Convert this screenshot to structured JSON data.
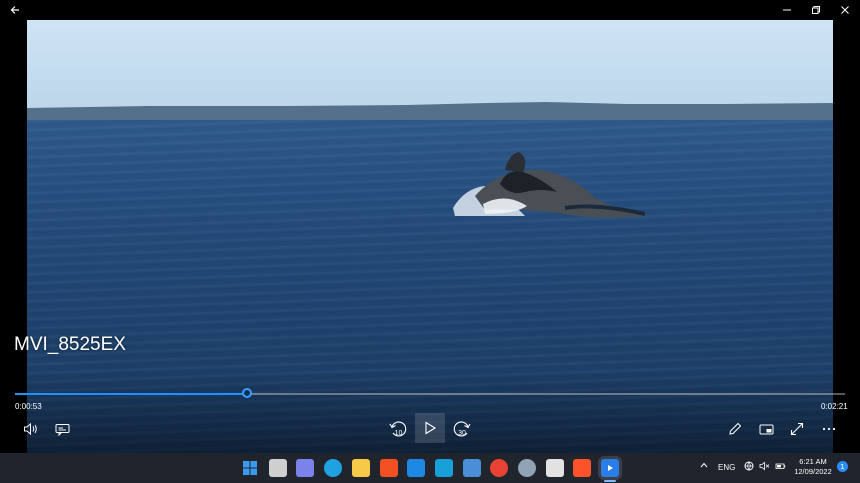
{
  "video": {
    "title": "MVI_8525EX",
    "elapsed": "0:00:53",
    "duration": "0:02:21",
    "progress": 0.2809
  },
  "controls": {
    "skip_back_label": "10",
    "skip_forward_label": "30"
  },
  "taskbar": {
    "tray": {
      "language": "ENG",
      "time": "6:21 AM",
      "date": "12/09/2022",
      "notification_count": "1"
    },
    "apps": [
      {
        "icon": "windows-start-icon",
        "color": "#3a9bf0"
      },
      {
        "icon": "task-view-icon",
        "color": "#cfcfcf"
      },
      {
        "icon": "chat-icon",
        "color": "#7b83eb"
      },
      {
        "icon": "edge-icon",
        "color": "#1fa3e0"
      },
      {
        "icon": "file-explorer-icon",
        "color": "#f7c948"
      },
      {
        "icon": "microsoft-store-icon",
        "color": "#f25022"
      },
      {
        "icon": "mail-icon",
        "color": "#1e88e5"
      },
      {
        "icon": "l-app-icon",
        "color": "#1aa0d8"
      },
      {
        "icon": "remote-desktop-icon",
        "color": "#4a8fd6"
      },
      {
        "icon": "chrome-icon",
        "color": "#e94235"
      },
      {
        "icon": "settings-icon",
        "color": "#8fa3b5"
      },
      {
        "icon": "snipping-tool-icon",
        "color": "#e2e2e2"
      },
      {
        "icon": "brave-icon",
        "color": "#fb542b"
      },
      {
        "icon": "media-player-icon",
        "color": "#2b7de9"
      }
    ]
  }
}
